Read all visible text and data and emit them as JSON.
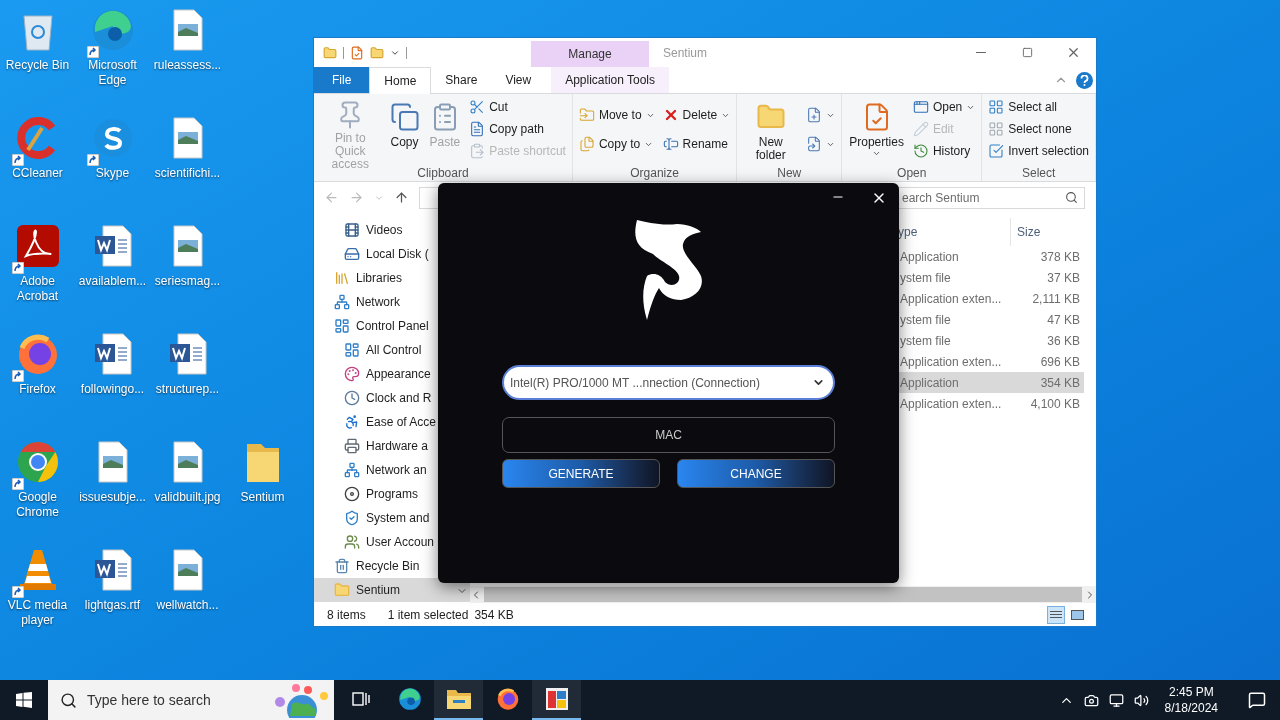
{
  "desktop_icons": [
    {
      "label": "Recycle Bin",
      "kind": "recycle",
      "shortcut": false
    },
    {
      "label": "Microsoft Edge",
      "kind": "edge",
      "shortcut": true
    },
    {
      "label": "ruleassess...",
      "kind": "image",
      "shortcut": false
    },
    {
      "label": "CCleaner",
      "kind": "ccleaner",
      "shortcut": true
    },
    {
      "label": "Skype",
      "kind": "skype",
      "shortcut": true
    },
    {
      "label": "scientifichi...",
      "kind": "image",
      "shortcut": false
    },
    {
      "label": "Adobe Acrobat",
      "kind": "pdf",
      "shortcut": true
    },
    {
      "label": "availablem...",
      "kind": "word",
      "shortcut": false
    },
    {
      "label": "seriesmag...",
      "kind": "image",
      "shortcut": false
    },
    {
      "label": "Firefox",
      "kind": "firefox",
      "shortcut": true
    },
    {
      "label": "followingo...",
      "kind": "word",
      "shortcut": false
    },
    {
      "label": "structurep...",
      "kind": "word",
      "shortcut": false
    },
    {
      "label": "Google Chrome",
      "kind": "chrome",
      "shortcut": true
    },
    {
      "label": "issuesubje...",
      "kind": "image",
      "shortcut": false
    },
    {
      "label": "validbuilt.jpg",
      "kind": "image",
      "shortcut": false
    },
    {
      "label": "Sentium",
      "kind": "folder",
      "shortcut": false
    },
    {
      "label": "VLC media player",
      "kind": "vlc",
      "shortcut": true
    },
    {
      "label": "lightgas.rtf",
      "kind": "word",
      "shortcut": false
    },
    {
      "label": "wellwatch...",
      "kind": "image",
      "shortcut": false
    }
  ],
  "explorer": {
    "context_group": "Manage",
    "title": "Sentium",
    "tabs": [
      {
        "label": "File",
        "kind": "file",
        "selected": false
      },
      {
        "label": "Home",
        "kind": "plain",
        "selected": true
      },
      {
        "label": "Share",
        "kind": "plain",
        "selected": false
      },
      {
        "label": "View",
        "kind": "plain",
        "selected": false
      },
      {
        "label": "Application Tools",
        "kind": "context",
        "selected": false
      }
    ],
    "ribbon_groups": [
      {
        "label": "Clipboard",
        "columns": [
          {
            "kind": "large",
            "commands": [
              {
                "label": "Pin to Quick access",
                "kind": "pin",
                "disabled": true,
                "dropdown": false
              }
            ]
          },
          {
            "kind": "large",
            "commands": [
              {
                "label": "Copy",
                "kind": "copy",
                "disabled": false,
                "dropdown": false
              }
            ]
          },
          {
            "kind": "large",
            "commands": [
              {
                "label": "Paste",
                "kind": "paste",
                "disabled": true,
                "dropdown": false
              }
            ]
          },
          {
            "kind": "small",
            "commands": [
              {
                "label": "Cut",
                "kind": "cut",
                "disabled": false,
                "dropdown": false
              },
              {
                "label": "Copy path",
                "kind": "copy-path",
                "disabled": false,
                "dropdown": false
              },
              {
                "label": "Paste shortcut",
                "kind": "paste-shortcut",
                "disabled": true,
                "dropdown": false
              }
            ]
          }
        ]
      },
      {
        "label": "Organize",
        "columns": [
          {
            "kind": "small",
            "commands": [
              {
                "label": "Move to",
                "kind": "move-to",
                "disabled": false,
                "dropdown": true
              },
              {
                "label": "Copy to",
                "kind": "copy-to",
                "disabled": false,
                "dropdown": true
              }
            ]
          },
          {
            "kind": "small",
            "commands": [
              {
                "label": "Delete",
                "kind": "delete",
                "disabled": false,
                "dropdown": true
              },
              {
                "label": "Rename",
                "kind": "rename",
                "disabled": false,
                "dropdown": false
              }
            ]
          }
        ]
      },
      {
        "label": "New",
        "columns": [
          {
            "kind": "large",
            "commands": [
              {
                "label": "New folder",
                "kind": "new-folder",
                "disabled": false,
                "dropdown": false
              }
            ]
          },
          {
            "kind": "small",
            "commands": [
              {
                "kind": "new-item",
                "disabled": false,
                "dropdown": true
              },
              {
                "kind": "easy-access",
                "disabled": false,
                "dropdown": true
              }
            ]
          }
        ]
      },
      {
        "label": "Open",
        "columns": [
          {
            "kind": "large",
            "commands": [
              {
                "label": "Properties",
                "kind": "properties",
                "disabled": false,
                "dropdown": true
              }
            ]
          },
          {
            "kind": "small",
            "commands": [
              {
                "label": "Open",
                "kind": "open",
                "disabled": false,
                "dropdown": true
              },
              {
                "label": "Edit",
                "kind": "edit",
                "disabled": true,
                "dropdown": false
              },
              {
                "label": "History",
                "kind": "history",
                "disabled": false,
                "dropdown": false
              }
            ]
          }
        ]
      },
      {
        "label": "Select",
        "columns": [
          {
            "kind": "small",
            "commands": [
              {
                "label": "Select all",
                "kind": "select-all",
                "disabled": false,
                "dropdown": false
              },
              {
                "label": "Select none",
                "kind": "select-none",
                "disabled": false,
                "dropdown": false
              },
              {
                "label": "Invert selection",
                "kind": "invert",
                "disabled": false,
                "dropdown": false
              }
            ]
          }
        ]
      }
    ],
    "search": {
      "placeholder": "earch Sentium"
    },
    "nav_pane": [
      {
        "children": [
          {
            "label": "Videos",
            "kind": "videos",
            "selected": false
          },
          {
            "label": "Local Disk (",
            "kind": "drive",
            "selected": false
          }
        ]
      },
      {
        "label": "Libraries",
        "kind": "libraries",
        "selected": false
      },
      {
        "label": "Network",
        "kind": "network",
        "selected": false
      },
      {
        "label": "Control Panel",
        "kind": "control-panel",
        "selected": false,
        "children": [
          {
            "label": "All Control",
            "kind": "control-panel",
            "selected": false
          },
          {
            "label": "Appearance",
            "kind": "appearance",
            "selected": false
          },
          {
            "label": "Clock and R",
            "kind": "clock",
            "selected": false
          },
          {
            "label": "Ease of Acce",
            "kind": "ease",
            "selected": false
          },
          {
            "label": "Hardware a",
            "kind": "hardware",
            "selected": false
          },
          {
            "label": "Network an",
            "kind": "network",
            "selected": false
          },
          {
            "label": "Programs",
            "kind": "programs",
            "selected": false
          },
          {
            "label": "System and",
            "kind": "system",
            "selected": false
          },
          {
            "label": "User Accoun",
            "kind": "users",
            "selected": false
          }
        ]
      },
      {
        "label": "Recycle Bin",
        "kind": "recycle",
        "selected": false
      },
      {
        "label": "Sentium",
        "kind": "folder",
        "selected": true
      }
    ],
    "columns": [
      "ype",
      "Size"
    ],
    "files": [
      {
        "type": "Application",
        "size": "378 KB",
        "selected": false
      },
      {
        "type": "ystem file",
        "size": "37 KB",
        "selected": false
      },
      {
        "type": "Application exten...",
        "size": "2,111 KB",
        "selected": false
      },
      {
        "type": "ystem file",
        "size": "47 KB",
        "selected": false
      },
      {
        "type": "ystem file",
        "size": "36 KB",
        "selected": false
      },
      {
        "type": "Application exten...",
        "size": "696 KB",
        "selected": false
      },
      {
        "type": "Application",
        "size": "354 KB",
        "selected": true
      },
      {
        "type": "Application exten...",
        "size": "4,100 KB",
        "selected": false
      }
    ],
    "status": {
      "count": "8 items",
      "selection": "1 item selected",
      "selection_size": "354 KB"
    }
  },
  "dialog": {
    "adapter": "Intel(R) PRO/1000 MT ...nnection (Connection)",
    "mac_placeholder": "MAC",
    "buttons": [
      "GENERATE",
      "CHANGE"
    ]
  },
  "taskbar": {
    "search_placeholder": "Type here to search",
    "apps": [
      {
        "kind": "taskview",
        "running": false
      },
      {
        "kind": "edge",
        "running": false
      },
      {
        "kind": "explorer",
        "running": true
      },
      {
        "kind": "firefox",
        "running": false
      },
      {
        "kind": "app",
        "running": true
      }
    ],
    "time": "2:45 PM",
    "date": "8/18/2024"
  }
}
